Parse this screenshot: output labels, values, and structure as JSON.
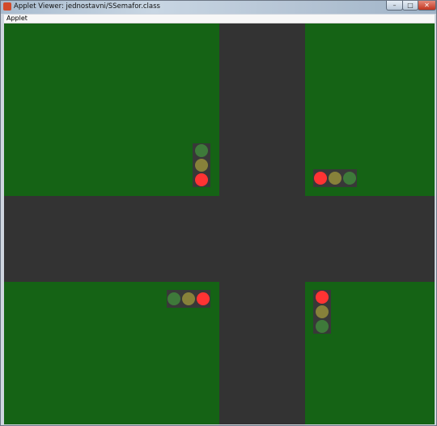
{
  "window": {
    "title": "Applet Viewer: jednostavni/SSemafor.class",
    "minimize_glyph": "–",
    "maximize_glyph": "□",
    "close_glyph": "✕"
  },
  "menu": {
    "items": [
      "Applet"
    ]
  },
  "colors": {
    "grass": "#156315",
    "road": "#333333",
    "housing": "#383838",
    "red_on": "#ff3333",
    "yellow_off": "#87813a",
    "green_off": "#3e7a3a"
  },
  "traffic_lights": [
    {
      "id": "north-west",
      "orientation": "vertical",
      "lamps": [
        "green",
        "yellow",
        "red"
      ],
      "active": "red"
    },
    {
      "id": "north-east",
      "orientation": "horizontal",
      "lamps": [
        "red",
        "yellow",
        "green"
      ],
      "active": "red"
    },
    {
      "id": "south-west",
      "orientation": "horizontal",
      "lamps": [
        "green",
        "yellow",
        "red"
      ],
      "active": "red"
    },
    {
      "id": "south-east",
      "orientation": "vertical",
      "lamps": [
        "red",
        "yellow",
        "green"
      ],
      "active": "red"
    }
  ]
}
